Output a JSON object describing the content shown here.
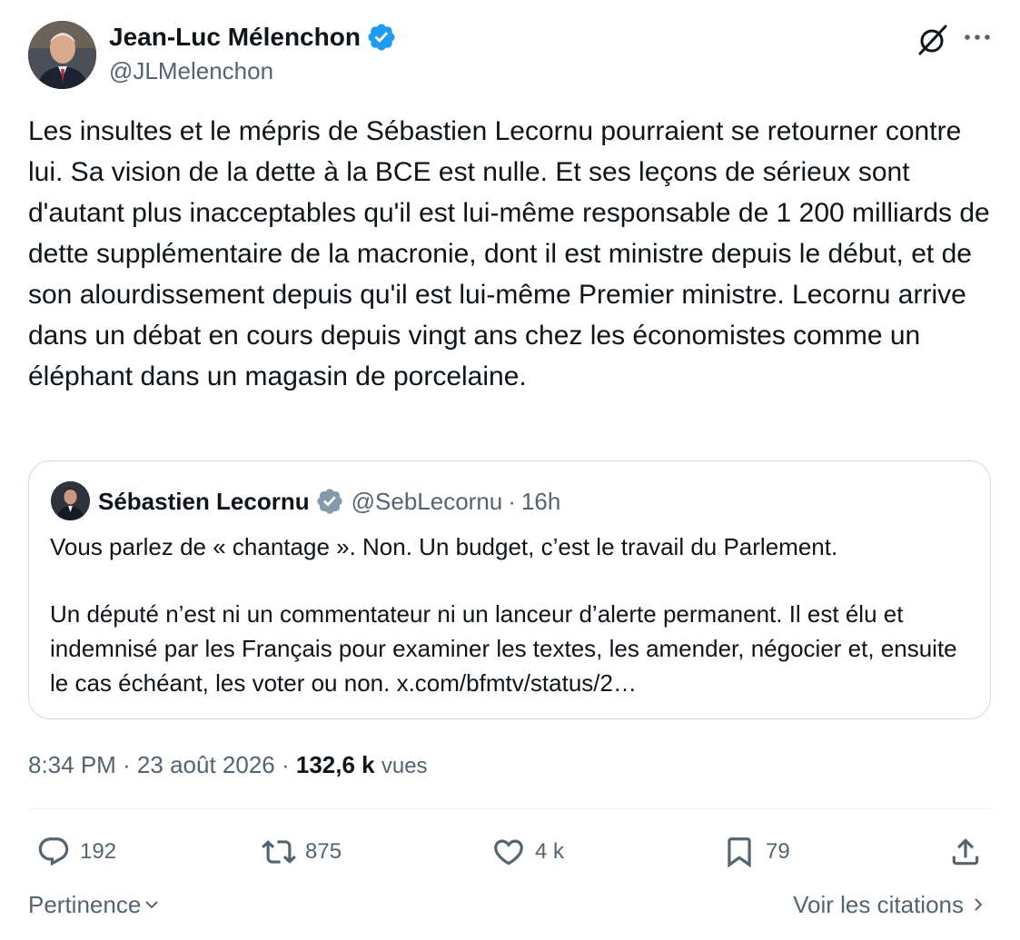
{
  "author": {
    "name": "Jean-Luc Mélenchon",
    "handle": "@JLMelenchon",
    "verified_icon": "verified-badge-icon"
  },
  "header_icons": [
    "grok-icon",
    "more-icon"
  ],
  "tweet": {
    "text": "Les insultes et le mépris de Sébastien Lecornu pourraient se retourner contre lui. Sa vision de la dette à la BCE est nulle. Et ses leçons de sérieux sont d'autant plus inacceptables qu'il est lui-même responsable de 1 200 milliards de dette supplémentaire de la macronie, dont il est ministre depuis le début, et de son alourdissement depuis qu'il est lui-même Premier ministre. Lecornu arrive dans un débat en cours depuis vingt ans chez les économistes comme un éléphant dans un magasin de porcelaine."
  },
  "quote": {
    "name": "Sébastien Lecornu",
    "handle": "@SebLecornu",
    "separator": "·",
    "time": "16h",
    "paragraph1": "Vous parlez de « chantage ». Non. Un budget, c’est le travail du Parlement.",
    "paragraph2": "Un député n’est ni un commentateur ni un lanceur d’alerte permanent. Il est élu et indemnisé par les Français pour examiner les textes, les amender, négocier et, ensuite le cas échéant, les voter ou non. x.com/bfmtv/status/2…"
  },
  "meta": {
    "time_date": "8:34 PM · 23 août 2026 · ",
    "views_count": "132,6 k",
    "views_label": "vues"
  },
  "actions": {
    "replies": "192",
    "reposts": "875",
    "likes": "4 k",
    "bookmarks": "79"
  },
  "footer": {
    "sort_label": "Pertinence",
    "quotes_link": "Voir les citations"
  },
  "colors": {
    "text_primary": "#0f1419",
    "text_secondary": "#536471",
    "verified_blue": "#1d9bf0",
    "verified_grey": "#829aab",
    "border": "#cfd9de"
  }
}
